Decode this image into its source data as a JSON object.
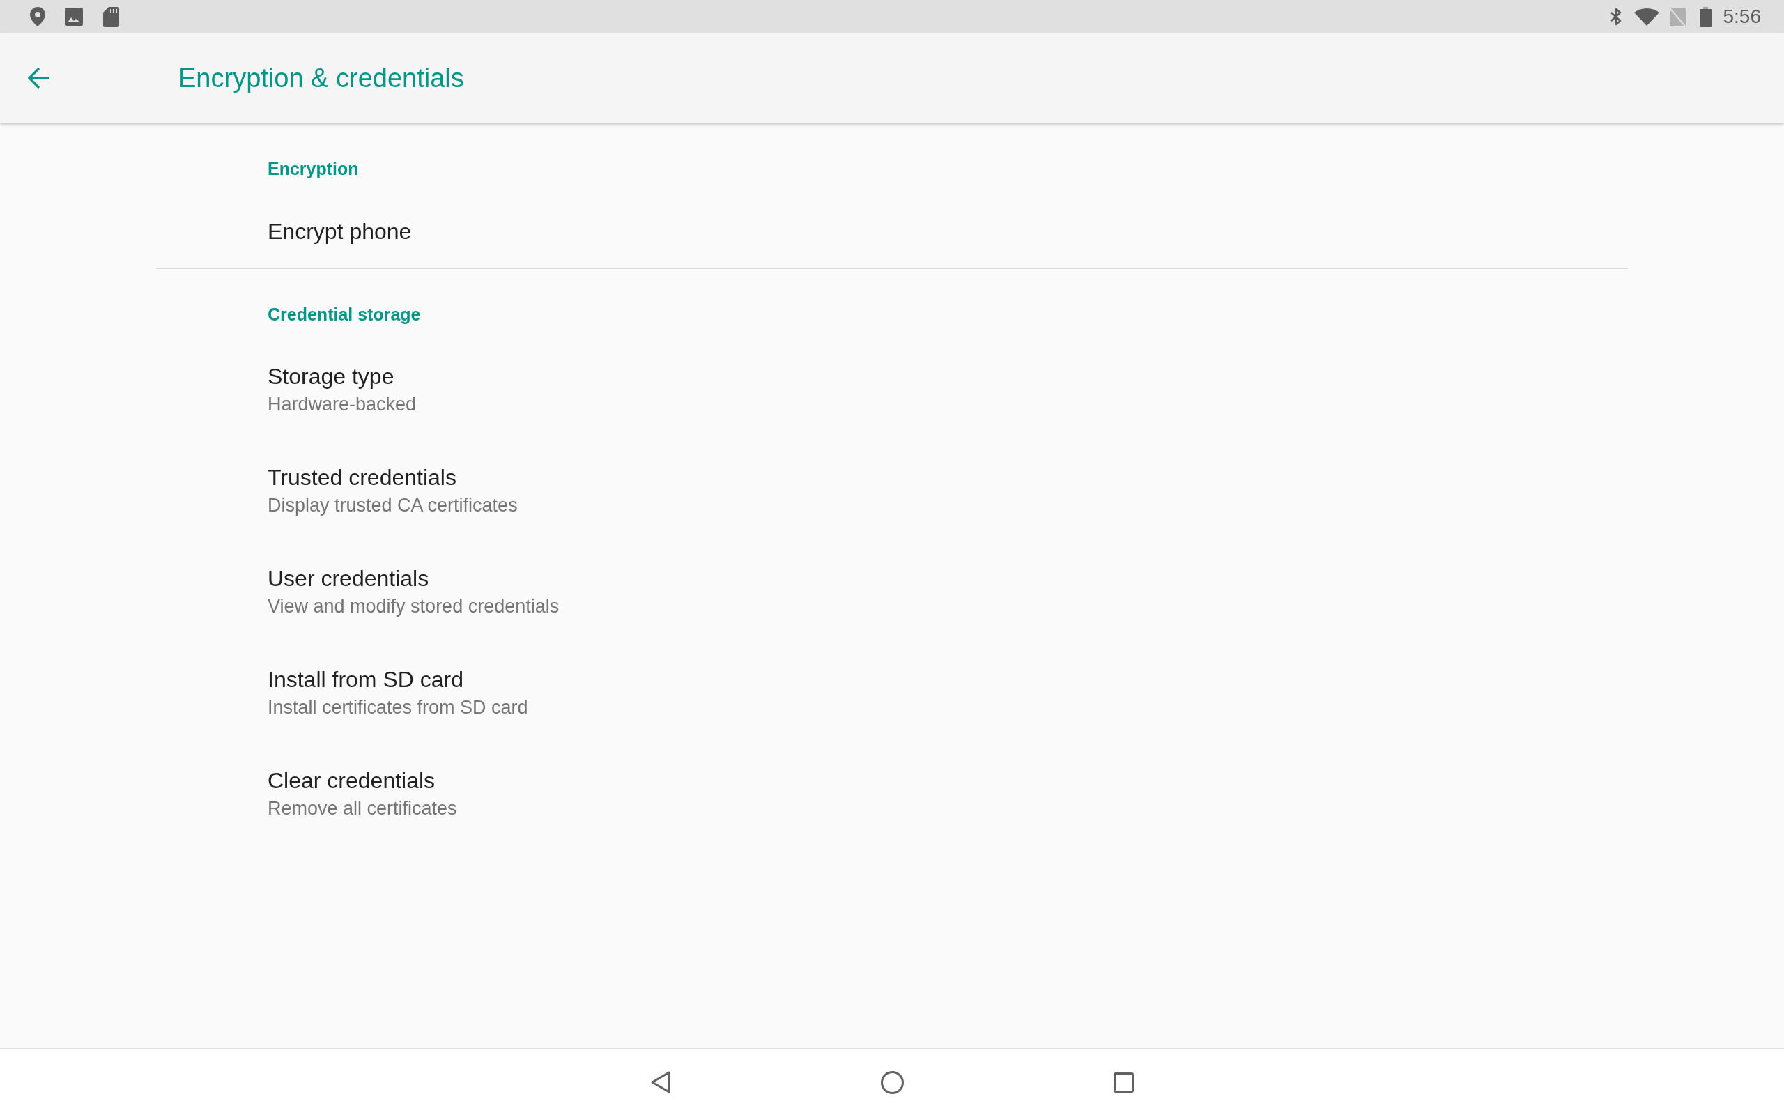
{
  "status_bar": {
    "time": "5:56"
  },
  "app_bar": {
    "title": "Encryption & credentials"
  },
  "sections": [
    {
      "header": "Encryption",
      "items": [
        {
          "title": "Encrypt phone"
        }
      ]
    },
    {
      "header": "Credential storage",
      "items": [
        {
          "title": "Storage type",
          "summary": "Hardware-backed"
        },
        {
          "title": "Trusted credentials",
          "summary": "Display trusted CA certificates"
        },
        {
          "title": "User credentials",
          "summary": "View and modify stored credentials"
        },
        {
          "title": "Install from SD card",
          "summary": "Install certificates from SD card"
        },
        {
          "title": "Clear credentials",
          "summary": "Remove all certificates"
        }
      ]
    }
  ]
}
